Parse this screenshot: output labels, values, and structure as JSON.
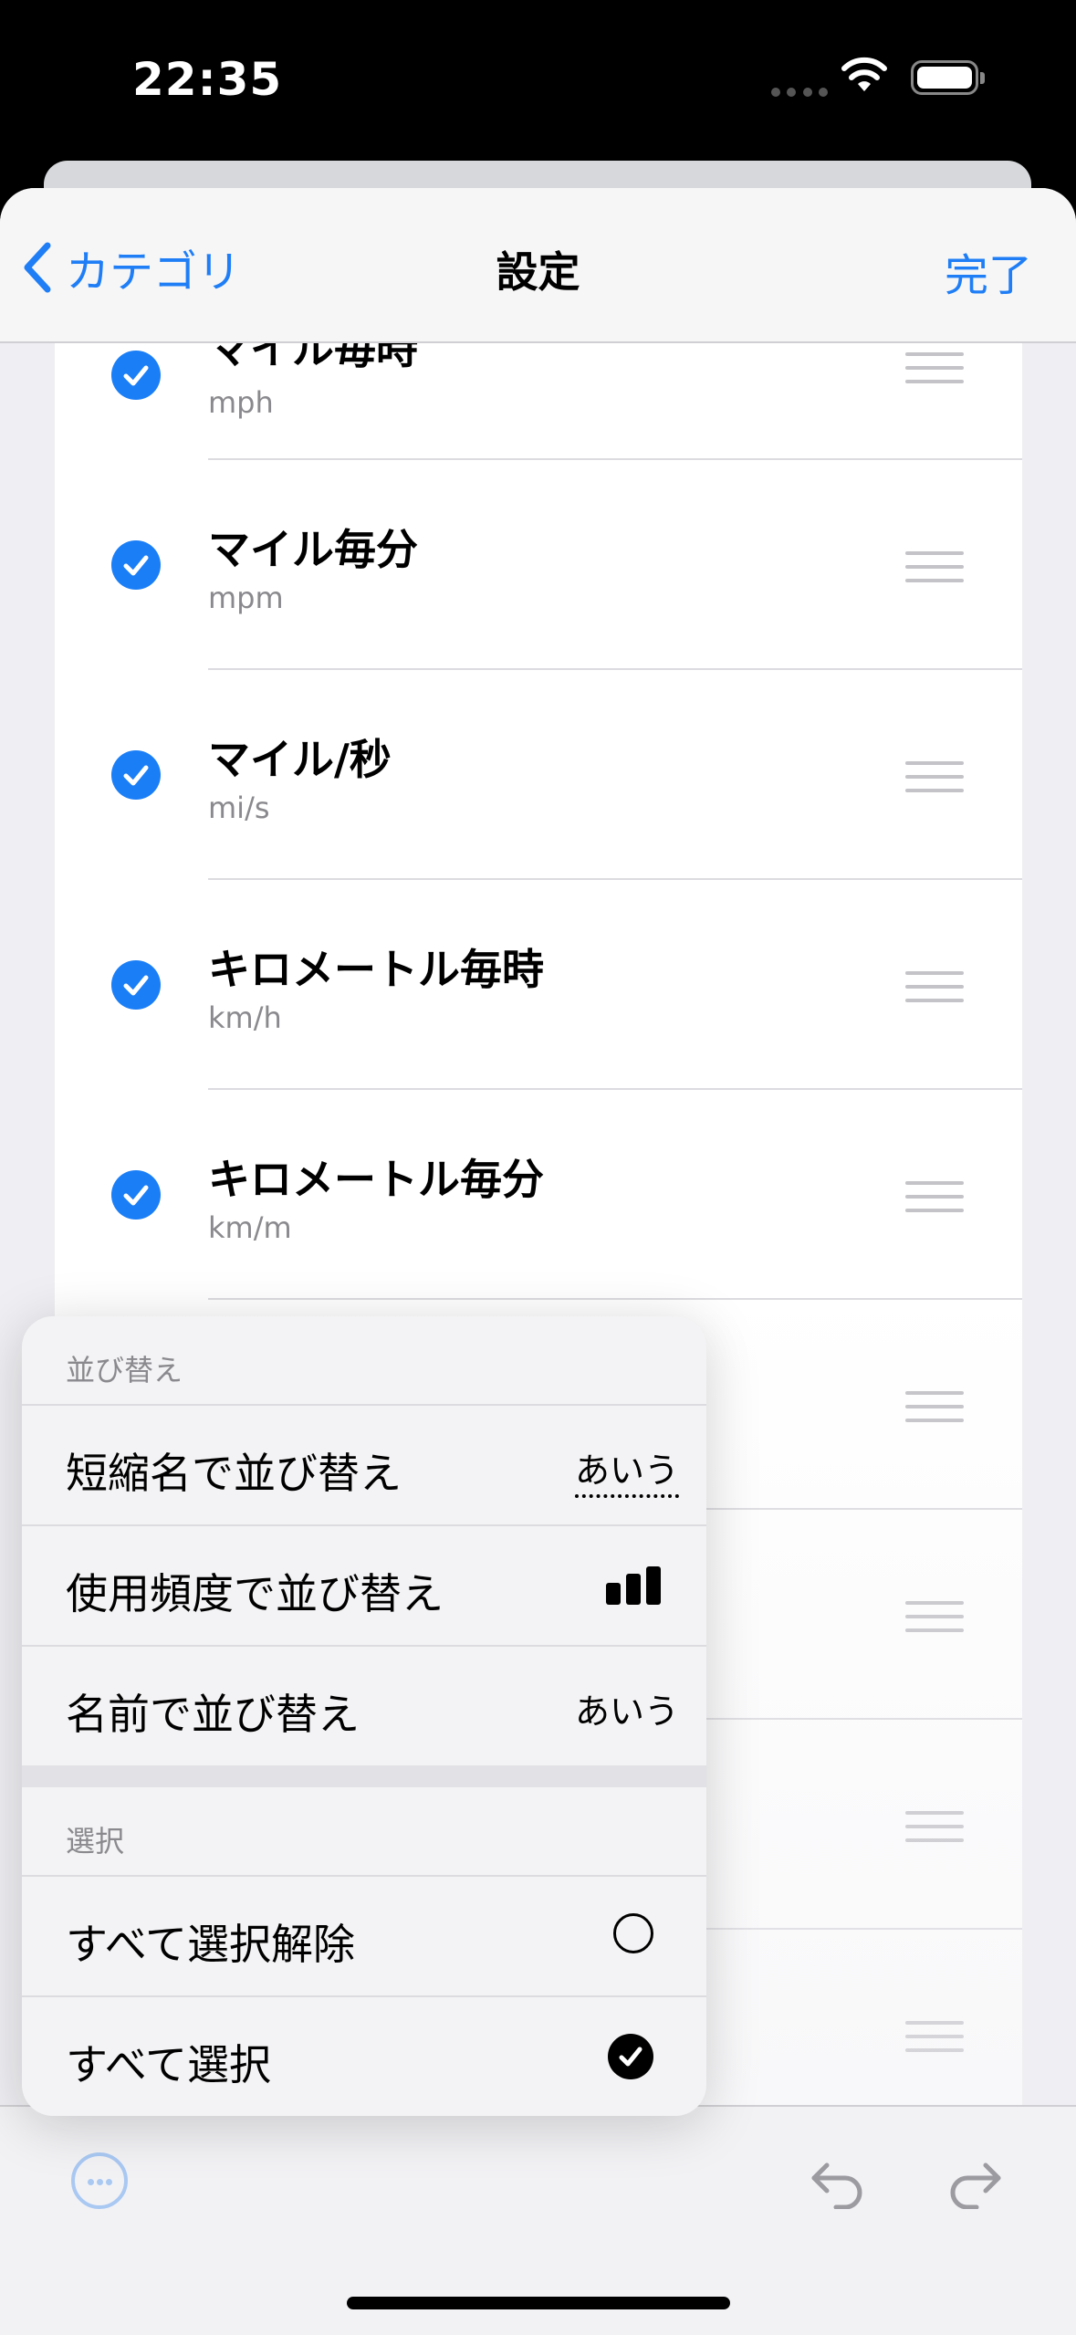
{
  "status": {
    "time": "22:35"
  },
  "nav": {
    "back_label": "カテゴリ",
    "title": "設定",
    "done_label": "完了"
  },
  "rows": [
    {
      "title": "マイル毎時",
      "subtitle": "mph",
      "checked": true
    },
    {
      "title": "マイル毎分",
      "subtitle": "mpm",
      "checked": true
    },
    {
      "title": "マイル/秒",
      "subtitle": "mi/s",
      "checked": true
    },
    {
      "title": "キロメートル毎時",
      "subtitle": "km/h",
      "checked": true
    },
    {
      "title": "キロメートル毎分",
      "subtitle": "km/m",
      "checked": true
    }
  ],
  "menu": {
    "sort_header": "並び替え",
    "sort_short": {
      "label": "短縮名で並び替え",
      "icon_text": "あいう"
    },
    "sort_usage": {
      "label": "使用頻度で並び替え",
      "icon": "bar-chart-icon"
    },
    "sort_name": {
      "label": "名前で並び替え",
      "icon_text": "あいう"
    },
    "select_header": "選択",
    "deselect_all": {
      "label": "すべて選択解除",
      "icon": "empty-circle-icon"
    },
    "select_all": {
      "label": "すべて選択",
      "icon": "checkmark-circle-icon"
    }
  },
  "toolbar": {
    "more": "ellipsis-circle-icon",
    "undo": "undo-icon",
    "redo": "redo-icon"
  },
  "colors": {
    "accent": "#1f7ef6",
    "background": "#efeff3"
  }
}
